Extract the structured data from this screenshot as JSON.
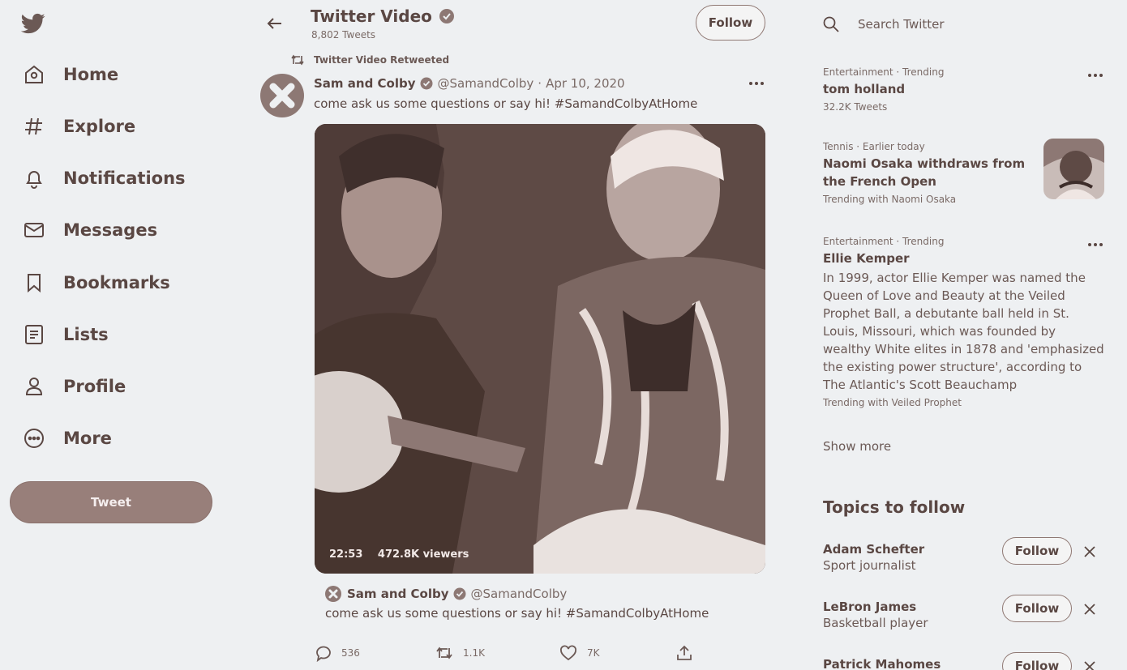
{
  "colors": {
    "ink": "#5a4743",
    "muted": "#7a6a66",
    "tweet_button": "#987f7a",
    "page_bg": "#eef0f2"
  },
  "nav": {
    "logo_icon": "twitter-bird-icon",
    "items": [
      {
        "label": "Home",
        "icon": "home-icon"
      },
      {
        "label": "Explore",
        "icon": "hashtag-icon"
      },
      {
        "label": "Notifications",
        "icon": "bell-icon"
      },
      {
        "label": "Messages",
        "icon": "envelope-icon"
      },
      {
        "label": "Bookmarks",
        "icon": "bookmark-icon"
      },
      {
        "label": "Lists",
        "icon": "list-icon"
      },
      {
        "label": "Profile",
        "icon": "person-icon"
      },
      {
        "label": "More",
        "icon": "more-circle-icon"
      }
    ],
    "tweet_button": "Tweet"
  },
  "header": {
    "title": "Twitter Video",
    "subtitle": "8,802 Tweets",
    "follow_label": "Follow"
  },
  "tweet": {
    "retweeted_by": "Twitter Video Retweeted",
    "author_name": "Sam and Colby",
    "handle": "@SamandColby",
    "separator": "·",
    "date": "Apr 10, 2020",
    "text": "come ask us some questions or say hi! #SamandColbyAtHome",
    "video": {
      "duration": "22:53",
      "viewers": "472.8K viewers"
    },
    "quote": {
      "author_name": "Sam and Colby",
      "handle": "@SamandColby",
      "text": "come ask us some questions or say hi! #SamandColbyAtHome"
    },
    "actions": {
      "replies": "536",
      "retweets": "1.1K",
      "likes": "7K"
    }
  },
  "sidebar": {
    "search_placeholder": "Search Twitter",
    "trends": [
      {
        "meta": "Entertainment · Trending",
        "title": "tom holland",
        "sub": "32.2K Tweets"
      },
      {
        "meta": "Tennis · Earlier today",
        "title": "Naomi Osaka withdraws from the French Open",
        "sub": "Trending with  Naomi Osaka"
      },
      {
        "meta": "Entertainment · Trending",
        "title": "Ellie Kemper",
        "desc": "In 1999, actor Ellie Kemper was named the Queen of Love and Beauty at the Veiled Prophet Ball, a debutante ball held in St. Louis, Missouri, which was founded by wealthy White elites in 1878 and 'emphasized the existing power structure', according to The Atlantic's Scott Beauchamp",
        "sub": "Trending with  Veiled Prophet"
      }
    ],
    "show_more": "Show more",
    "topics_title": "Topics to follow",
    "topics": [
      {
        "name": "Adam Schefter",
        "desc": "Sport journalist",
        "follow": "Follow"
      },
      {
        "name": "LeBron James",
        "desc": "Basketball player",
        "follow": "Follow"
      },
      {
        "name": "Patrick Mahomes",
        "desc": "",
        "follow": "Follow"
      }
    ]
  }
}
